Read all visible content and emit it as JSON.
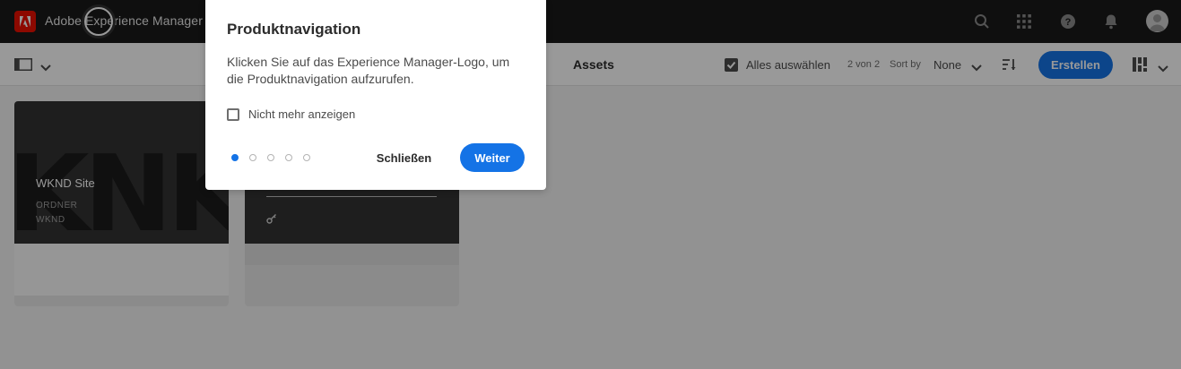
{
  "shell": {
    "app_title": "Adobe Experience Manager"
  },
  "actionbar": {
    "title": "Assets",
    "select_all_label": "Alles auswählen",
    "count": "2 von 2",
    "sort_label": "Sort by",
    "sort_value": "None",
    "create_label": "Erstellen"
  },
  "cards": [
    {
      "title": "WKND Site",
      "type": "ORDNER",
      "name": "WKND",
      "thumb_text": "KNK"
    },
    {
      "title": "",
      "type": "",
      "name": ""
    }
  ],
  "dialog": {
    "title": "Produktnavigation",
    "body": "Klicken Sie auf das Experience Manager-Logo, um die Produktnavigation aufzurufen.",
    "checkbox_label": "Nicht mehr anzeigen",
    "close_label": "Schließen",
    "next_label": "Weiter",
    "step_current": 1,
    "step_total": 5
  },
  "icons": {
    "logo": "adobe-logo-icon",
    "search": "search-icon",
    "apps": "apps-grid-icon",
    "help": "help-icon",
    "notifications": "bell-icon",
    "rail": "rail-toggle-icon",
    "select_all": "checkbox-select-all-icon",
    "sort_direction": "sort-order-icon",
    "view": "card-view-icon"
  },
  "colors": {
    "accent": "#1473e6",
    "shell": "#1a1a1a",
    "adobe_red": "#eb1000"
  }
}
